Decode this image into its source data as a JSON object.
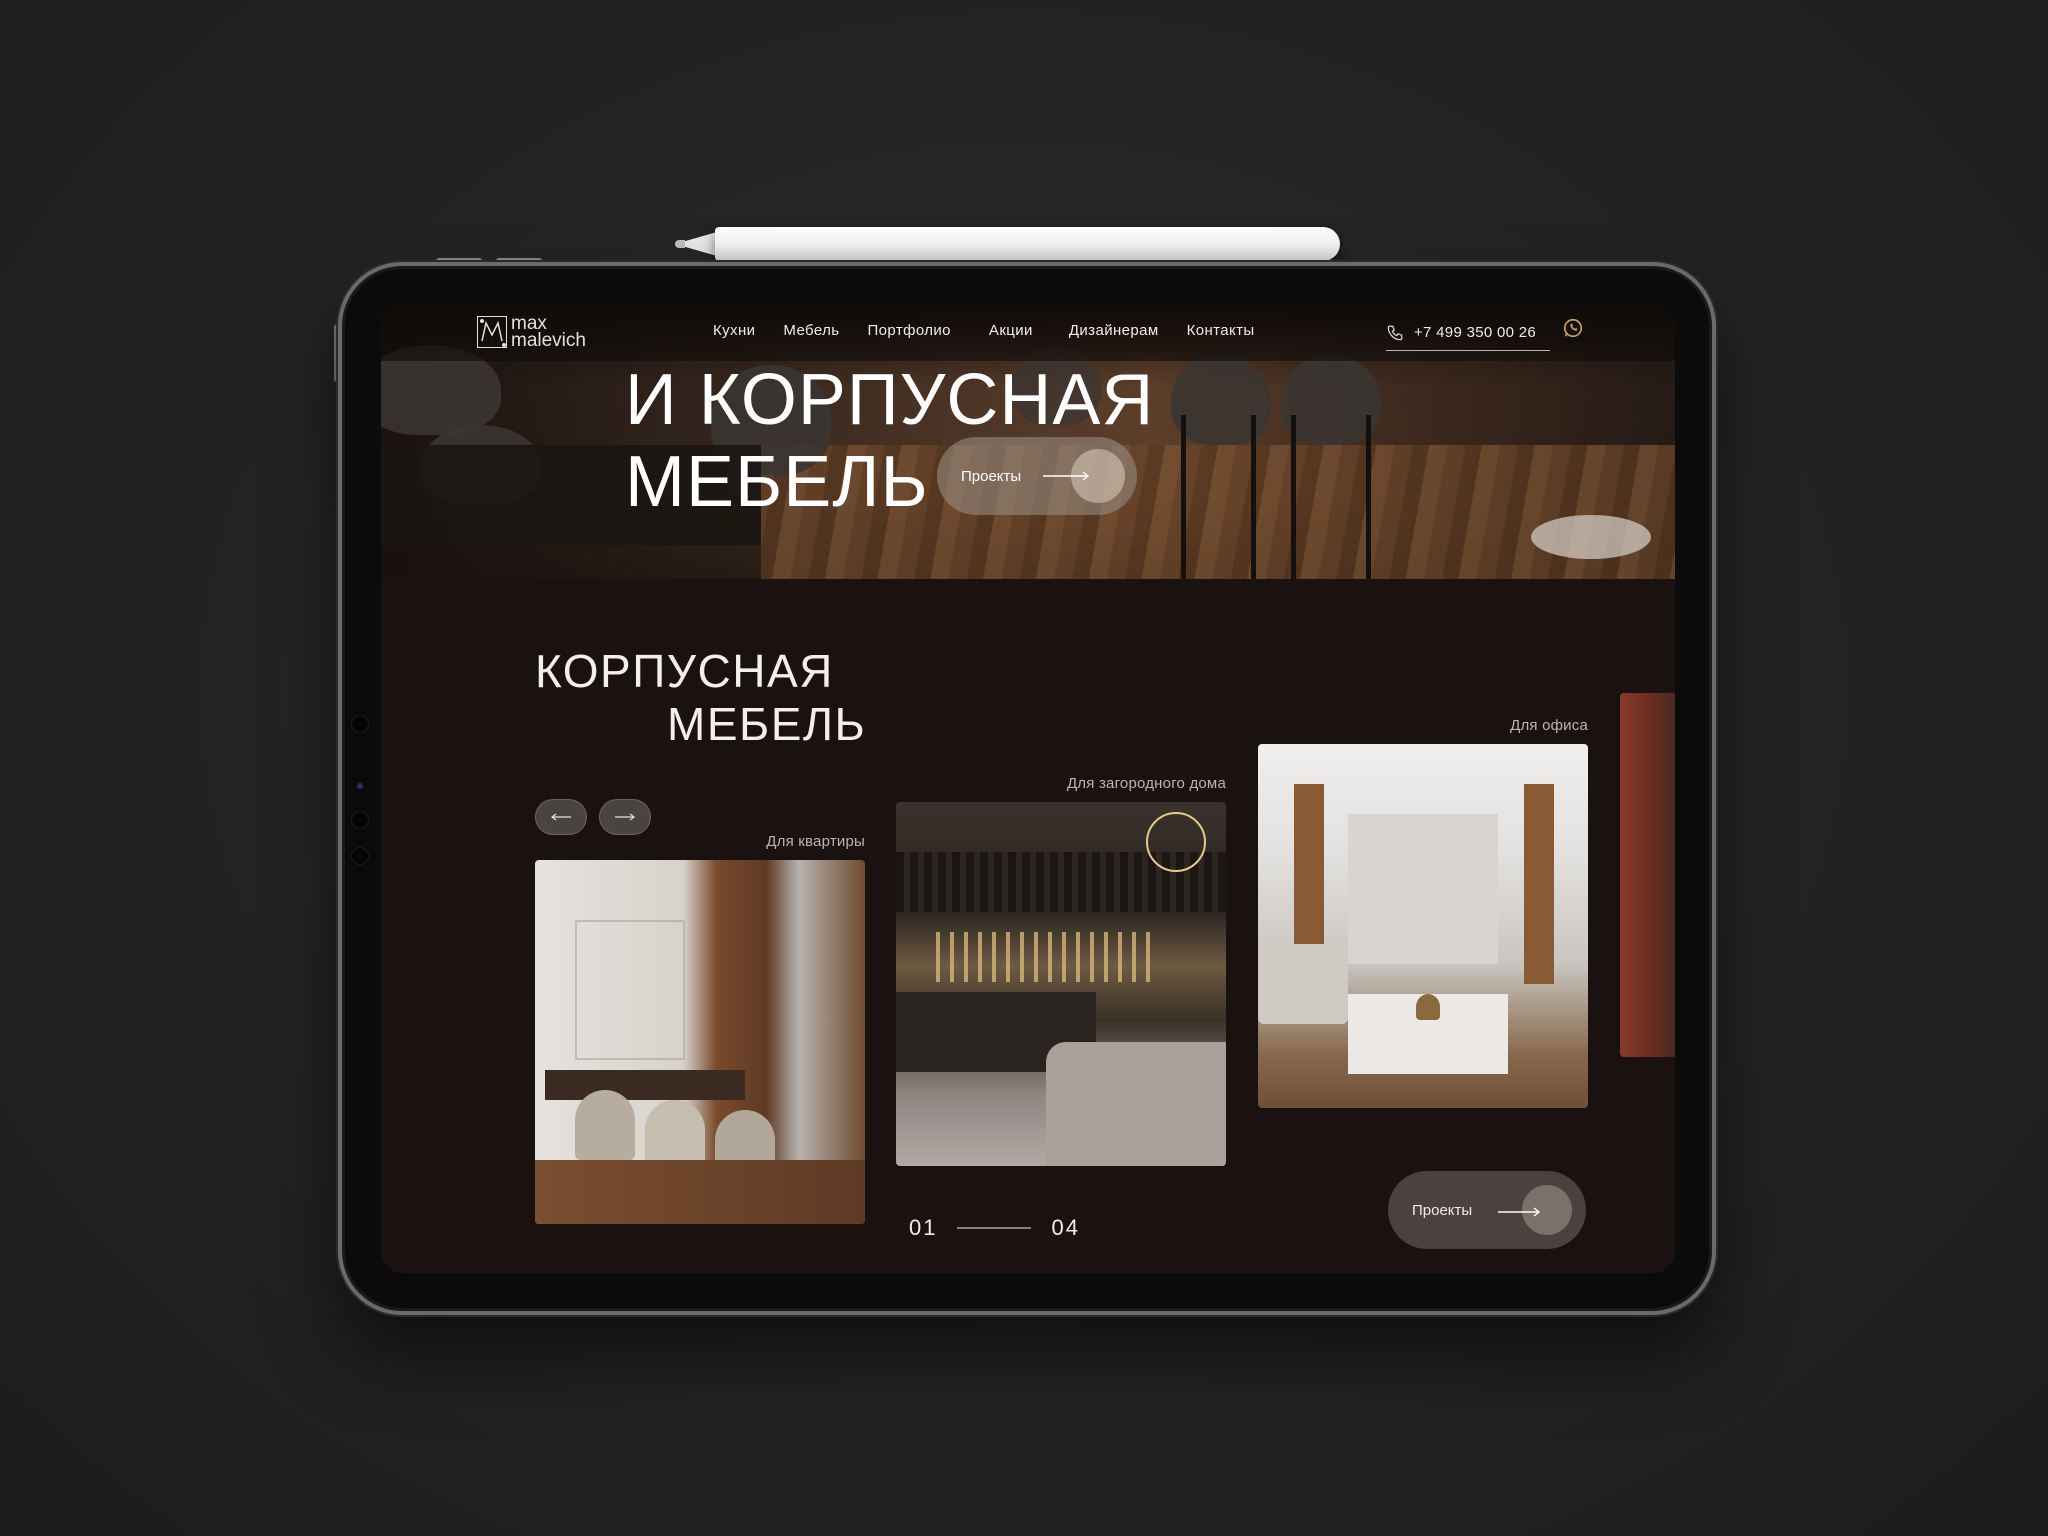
{
  "logo": {
    "line1": "max",
    "line2": "malevich"
  },
  "nav": {
    "items": [
      "Кухни",
      "Мебель",
      "Портфолио",
      "Акции",
      "Дизайнерам",
      "Контакты"
    ]
  },
  "contact": {
    "phone": "+7 499 350 00 26"
  },
  "hero": {
    "title_line1": "И КОРПУСНАЯ",
    "title_line2": "МЕБЕЛЬ",
    "button_label": "Проекты"
  },
  "section": {
    "title_line1": "КОРПУСНАЯ",
    "title_line2": "МЕБЕЛЬ",
    "cards": [
      {
        "caption": "Для квартиры"
      },
      {
        "caption": "Для загородного дома"
      },
      {
        "caption": "Для офиса"
      }
    ],
    "counter": {
      "current": "01",
      "total": "04"
    },
    "button_label": "Проекты"
  },
  "colors": {
    "background": "#1a1210",
    "text": "#f3efea",
    "button": "#4a423e"
  },
  "icons": [
    "phone-icon",
    "whatsapp-icon",
    "arrow-left-icon",
    "arrow-right-icon"
  ]
}
